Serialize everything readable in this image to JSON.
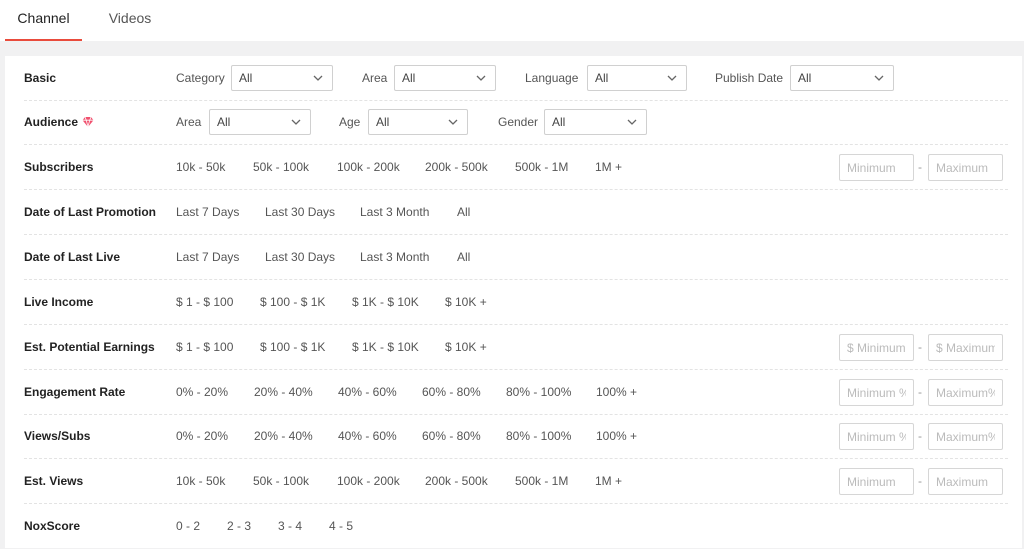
{
  "tabs": [
    {
      "label": "Channel",
      "active": true
    },
    {
      "label": "Videos",
      "active": false
    }
  ],
  "accent_color": "#e94b3c",
  "filters": {
    "basic": {
      "label": "Basic",
      "category": {
        "label": "Category",
        "value": "All"
      },
      "area": {
        "label": "Area",
        "value": "All"
      },
      "language": {
        "label": "Language",
        "value": "All"
      },
      "publish_date": {
        "label": "Publish Date",
        "value": "All"
      }
    },
    "audience": {
      "label": "Audience",
      "icon": "diamond-icon",
      "area": {
        "label": "Area",
        "value": "All"
      },
      "age": {
        "label": "Age",
        "value": "All"
      },
      "gender": {
        "label": "Gender",
        "value": "All"
      }
    },
    "subscribers": {
      "label": "Subscribers",
      "options": [
        "10k - 50k",
        "50k - 100k",
        "100k - 200k",
        "200k - 500k",
        "500k - 1M",
        "1M +"
      ],
      "min_placeholder": "Minimum",
      "max_placeholder": "Maximum"
    },
    "last_promotion": {
      "label": "Date of Last Promotion",
      "options": [
        "Last 7 Days",
        "Last 30 Days",
        "Last 3 Month",
        "All"
      ]
    },
    "last_live": {
      "label": "Date of Last Live",
      "options": [
        "Last 7 Days",
        "Last 30 Days",
        "Last 3 Month",
        "All"
      ]
    },
    "live_income": {
      "label": "Live Income",
      "options": [
        "$ 1 - $ 100",
        "$ 100 - $ 1K",
        "$ 1K - $ 10K",
        "$ 10K +"
      ]
    },
    "potential_earnings": {
      "label": "Est. Potential Earnings",
      "options": [
        "$ 1 - $ 100",
        "$ 100 - $ 1K",
        "$ 1K - $ 10K",
        "$ 10K +"
      ],
      "min_placeholder": "$ Minimum",
      "max_placeholder": "$ Maximum"
    },
    "engagement_rate": {
      "label": "Engagement Rate",
      "options": [
        "0% - 20%",
        "20% - 40%",
        "40% - 60%",
        "60% - 80%",
        "80% - 100%",
        "100% +"
      ],
      "min_placeholder": "Minimum %",
      "max_placeholder": "Maximum%"
    },
    "views_subs": {
      "label": "Views/Subs",
      "options": [
        "0% - 20%",
        "20% - 40%",
        "40% - 60%",
        "60% - 80%",
        "80% - 100%",
        "100% +"
      ],
      "min_placeholder": "Minimum %",
      "max_placeholder": "Maximum%"
    },
    "est_views": {
      "label": "Est. Views",
      "options": [
        "10k - 50k",
        "50k - 100k",
        "100k - 200k",
        "200k - 500k",
        "500k - 1M",
        "1M +"
      ],
      "min_placeholder": "Minimum",
      "max_placeholder": "Maximum"
    },
    "noxscore": {
      "label": "NoxScore",
      "options": [
        "0 - 2",
        "2 - 3",
        "3 - 4",
        "4 - 5"
      ]
    },
    "range_separator": "-"
  }
}
